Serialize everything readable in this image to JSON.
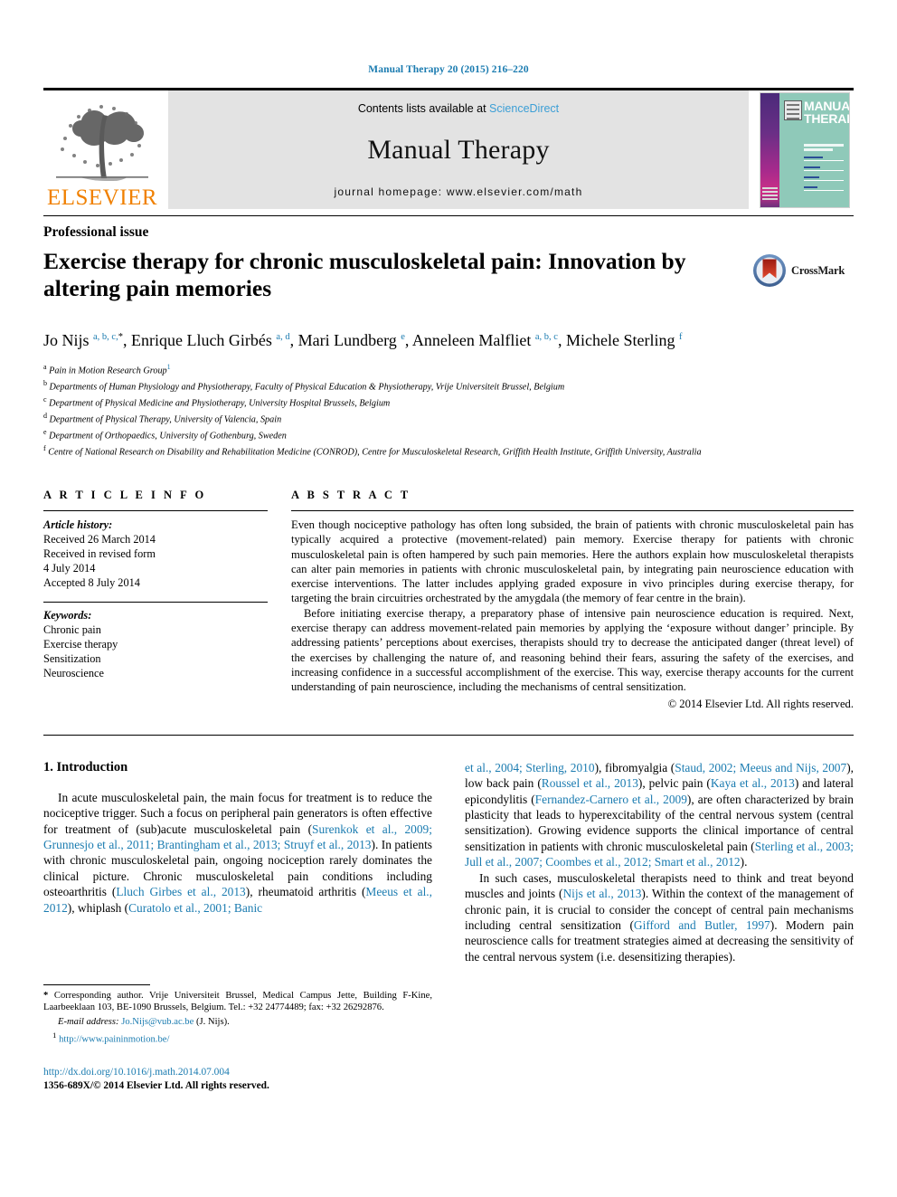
{
  "running_head": "Manual Therapy 20 (2015) 216–220",
  "masthead": {
    "publisher_logo_text": "ELSEVIER",
    "contents_prefix": "Contents lists available at ",
    "contents_link": "ScienceDirect",
    "journal_name": "Manual Therapy",
    "homepage_label": "journal homepage: www.elsevier.com/math",
    "cover": {
      "title_line1": "MANUAL",
      "title_line2": "THERAPY",
      "badge_name": "issn-badge"
    }
  },
  "article": {
    "section_label": "Professional issue",
    "title": "Exercise therapy for chronic musculoskeletal pain: Innovation by altering pain memories",
    "crossmark_label": "CrossMark",
    "authors": [
      {
        "name": "Jo Nijs",
        "sup": "a, b, c,",
        "star": "*"
      },
      {
        "name": "Enrique Lluch Girbés",
        "sup": "a, d",
        "star": ""
      },
      {
        "name": "Mari Lundberg",
        "sup": "e",
        "star": ""
      },
      {
        "name": "Anneleen Malfliet",
        "sup": "a, b, c",
        "star": ""
      },
      {
        "name": "Michele Sterling",
        "sup": "f",
        "star": ""
      }
    ],
    "affiliations": [
      {
        "mark": "a",
        "text": "Pain in Motion Research Group",
        "note": "1"
      },
      {
        "mark": "b",
        "text": "Departments of Human Physiology and Physiotherapy, Faculty of Physical Education & Physiotherapy, Vrije Universiteit Brussel, Belgium",
        "note": ""
      },
      {
        "mark": "c",
        "text": "Department of Physical Medicine and Physiotherapy, University Hospital Brussels, Belgium",
        "note": ""
      },
      {
        "mark": "d",
        "text": "Department of Physical Therapy, University of Valencia, Spain",
        "note": ""
      },
      {
        "mark": "e",
        "text": "Department of Orthopaedics, University of Gothenburg, Sweden",
        "note": ""
      },
      {
        "mark": "f",
        "text": "Centre of National Research on Disability and Rehabilitation Medicine (CONROD), Centre for Musculoskeletal Research, Griffith Health Institute, Griffith University, Australia",
        "note": ""
      }
    ]
  },
  "article_info": {
    "heading": "A R T I C L E  I N F O",
    "history_label": "Article history:",
    "history": [
      "Received 26 March 2014",
      "Received in revised form",
      "4 July 2014",
      "Accepted 8 July 2014"
    ],
    "keywords_label": "Keywords:",
    "keywords": [
      "Chronic pain",
      "Exercise therapy",
      "Sensitization",
      "Neuroscience"
    ]
  },
  "abstract": {
    "heading": "A B S T R A C T",
    "paragraphs": [
      "Even though nociceptive pathology has often long subsided, the brain of patients with chronic musculoskeletal pain has typically acquired a protective (movement-related) pain memory. Exercise therapy for patients with chronic musculoskeletal pain is often hampered by such pain memories. Here the authors explain how musculoskeletal therapists can alter pain memories in patients with chronic musculoskeletal pain, by integrating pain neuroscience education with exercise interventions. The latter includes applying graded exposure in vivo principles during exercise therapy, for targeting the brain circuitries orchestrated by the amygdala (the memory of fear centre in the brain).",
      "Before initiating exercise therapy, a preparatory phase of intensive pain neuroscience education is required. Next, exercise therapy can address movement-related pain memories by applying the ‘exposure without danger’ principle. By addressing patients’ perceptions about exercises, therapists should try to decrease the anticipated danger (threat level) of the exercises by challenging the nature of, and reasoning behind their fears, assuring the safety of the exercises, and increasing confidence in a successful accomplishment of the exercise. This way, exercise therapy accounts for the current understanding of pain neuroscience, including the mechanisms of central sensitization."
    ],
    "copyright": "© 2014 Elsevier Ltd. All rights reserved."
  },
  "body": {
    "intro_heading": "1. Introduction",
    "left_paragraph_html": "In acute musculoskeletal pain, the main focus for treatment is to reduce the nociceptive trigger. Such a focus on peripheral pain generators is often effective for treatment of (sub)acute musculoskeletal pain (<span class=\"ref\">Surenkok et al., 2009; Grunnesjo et al., 2011; Brantingham et al., 2013; Struyf et al., 2013</span>). In patients with chronic musculoskeletal pain, ongoing nociception rarely dominates the clinical picture. Chronic musculoskeletal pain conditions including osteoarthritis (<span class=\"ref\">Lluch Girbes et al., 2013</span>), rheumatoid arthritis (<span class=\"ref\">Meeus et al., 2012</span>), whiplash (<span class=\"ref\">Curatolo et al., 2001; Banic</span>",
    "right_paragraph1_html": "<span class=\"ref\">et al., 2004; Sterling, 2010</span>), fibromyalgia (<span class=\"ref\">Staud, 2002; Meeus and Nijs, 2007</span>), low back pain (<span class=\"ref\">Roussel et al., 2013</span>), pelvic pain (<span class=\"ref\">Kaya et al., 2013</span>) and lateral epicondylitis (<span class=\"ref\">Fernandez-Carnero et al., 2009</span>), are often characterized by brain plasticity that leads to hyperexcitability of the central nervous system (central sensitization). Growing evidence supports the clinical importance of central sensitization in patients with chronic musculoskeletal pain (<span class=\"ref\">Sterling et al., 2003; Jull et al., 2007; Coombes et al., 2012; Smart et al., 2012</span>).",
    "right_paragraph2_html": "In such cases, musculoskeletal therapists need to think and treat beyond muscles and joints (<span class=\"ref\">Nijs et al., 2013</span>). Within the context of the management of chronic pain, it is crucial to consider the concept of central pain mechanisms including central sensitization (<span class=\"ref\">Gifford and Butler, 1997</span>). Modern pain neuroscience calls for treatment strategies aimed at decreasing the sensitivity of the central nervous system (i.e. desensitizing therapies)."
  },
  "footnotes": {
    "corresponding_html": "<b>*</b> Corresponding author. Vrije Universiteit Brussel, Medical Campus Jette, Building F-Kine, Laarbeeklaan 103, BE-1090 Brussels, Belgium. Tel.: +32 24774489; fax: +32 26292876.",
    "email_label": "E-mail address:",
    "email_address": "Jo.Nijs@vub.ac.be",
    "email_owner": "(J. Nijs).",
    "note_mark": "1",
    "note_url": "http://www.paininmotion.be/",
    "doi": "http://dx.doi.org/10.1016/j.math.2014.07.004",
    "issn_line": "1356-689X/© 2014 Elsevier Ltd. All rights reserved."
  },
  "colors": {
    "link": "#1a7bb0",
    "sciencedirect": "#3c9fd6",
    "elsevier_orange": "#f08000",
    "cover_bg": "#8fc9b9",
    "masthead_bg": "#e3e3e3"
  }
}
